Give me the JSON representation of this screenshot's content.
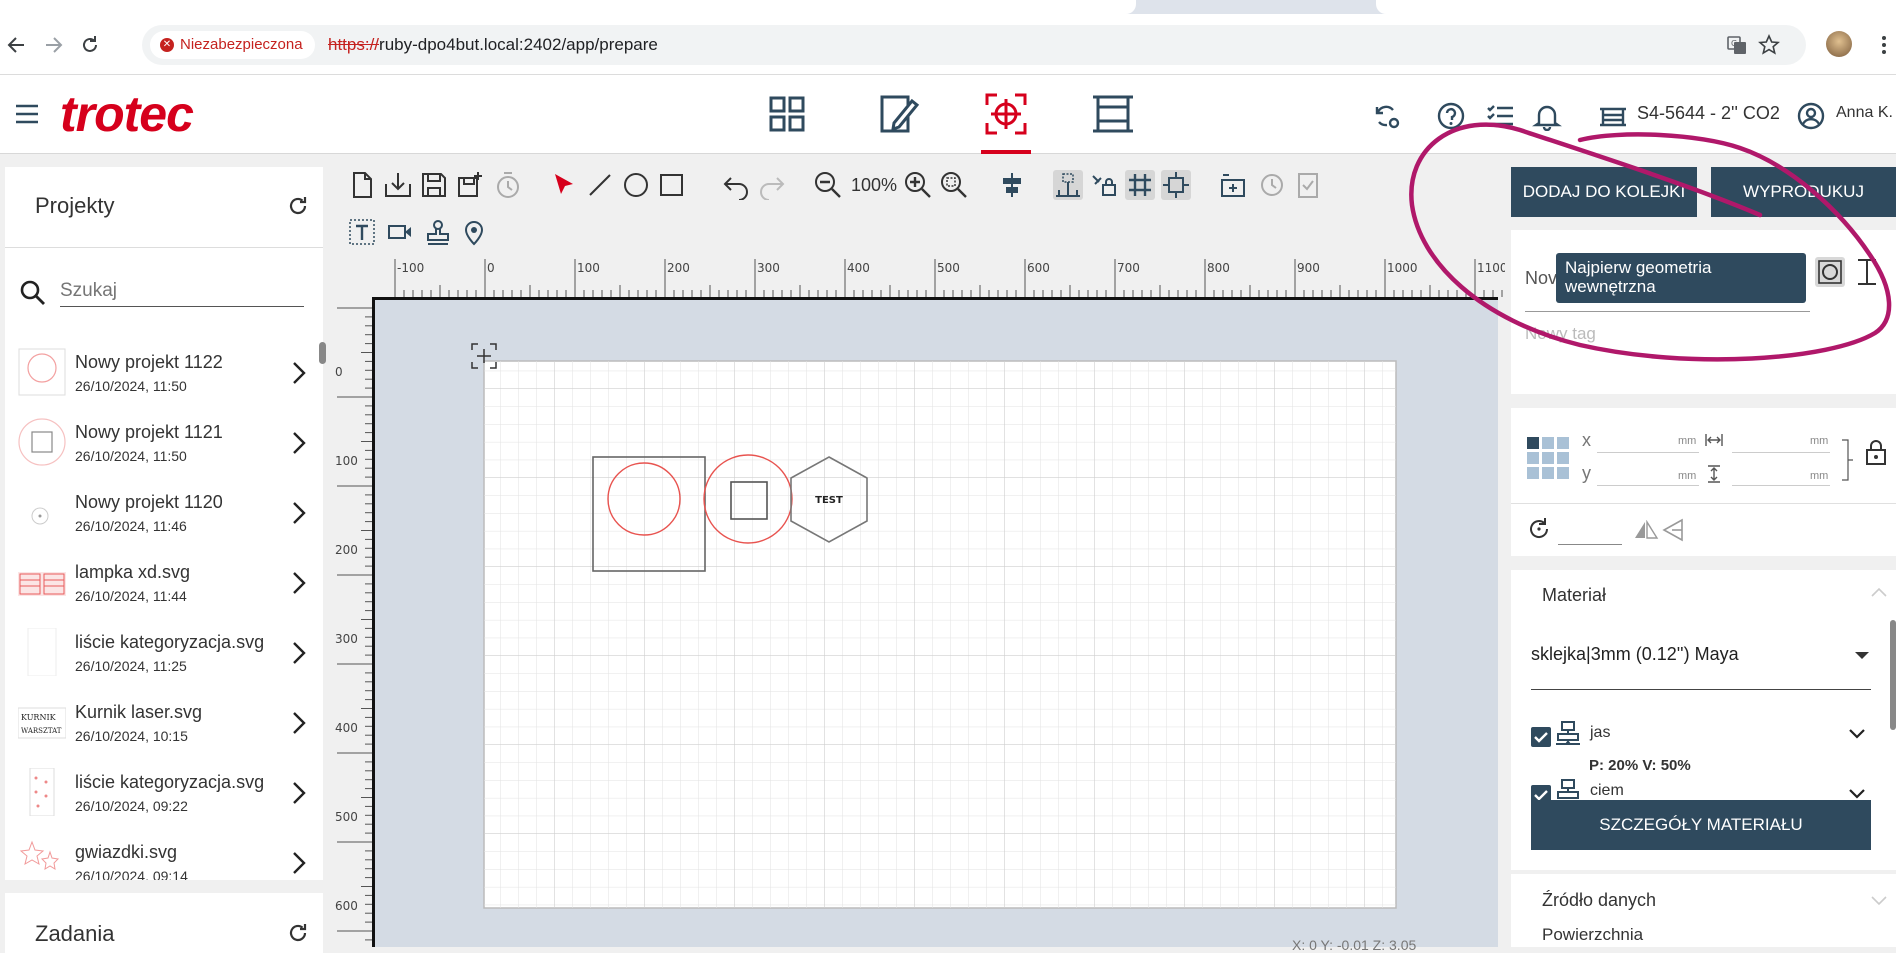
{
  "browser": {
    "security_label": "Niezabezpieczona",
    "url_scheme": "https://",
    "url_rest": "ruby-dpo4but.local:2402/app/prepare"
  },
  "header": {
    "logo": "trotec",
    "machine": "S4-5644 - 2'' CO2",
    "user": "Anna K."
  },
  "projects": {
    "title": "Projekty",
    "search_placeholder": "Szukaj",
    "items": [
      {
        "name": "Nowy projekt 1122",
        "date": "26/10/2024, 11:50"
      },
      {
        "name": "Nowy projekt 1121",
        "date": "26/10/2024, 11:50"
      },
      {
        "name": "Nowy projekt 1120",
        "date": "26/10/2024, 11:46"
      },
      {
        "name": "lampka xd.svg",
        "date": "26/10/2024, 11:44"
      },
      {
        "name": "liście kategoryzacja.svg",
        "date": "26/10/2024, 11:25"
      },
      {
        "name": "Kurnik laser.svg",
        "date": "26/10/2024, 10:15"
      },
      {
        "name": "liście kategoryzacja.svg",
        "date": "26/10/2024, 09:22"
      },
      {
        "name": "gwiazdki.svg",
        "date": "26/10/2024, 09:14"
      }
    ],
    "thumb_text": {
      "kurnik_1": "KURNIK",
      "kurnik_2": "WARSZTAT"
    }
  },
  "tasks": {
    "title": "Zadania"
  },
  "toolbar": {
    "zoom": "100%"
  },
  "workspace": {
    "ruler_top": [
      "-100",
      "0",
      "100",
      "200",
      "300",
      "400",
      "500",
      "600",
      "700",
      "800",
      "900",
      "1000",
      "1100"
    ],
    "ruler_left": [
      "0",
      "100",
      "200",
      "300",
      "400",
      "500",
      "600"
    ],
    "hexagon_text": "TEST",
    "coords": "X: 0   Y: -0.01   Z: 3.05"
  },
  "right_panel": {
    "add_to_queue": "DODAJ DO KOLEJKI",
    "produce": "WYPRODUKUJ",
    "tooltip": "Najpierw geometria wewnętrzna",
    "name_label": "Nov",
    "tag_placeholder": "Nowy tag",
    "x_label": "x",
    "y_label": "y",
    "unit": "mm",
    "material_title": "Materiał",
    "material_value": "sklejka|3mm (0.12'') Maya",
    "layers": [
      {
        "name": "jas",
        "params": "P: 20%   V: 50%"
      },
      {
        "name": "ciem"
      }
    ],
    "material_details": "SZCZEGÓŁY MATERIAŁU",
    "data_source_title": "Źródło danych",
    "surface_label": "Powierzchnia"
  },
  "colors": {
    "brand_red": "#d6001c",
    "primary_dark": "#2f4a5e",
    "annotation": "#b0186a",
    "shape_red": "#e8534f"
  }
}
